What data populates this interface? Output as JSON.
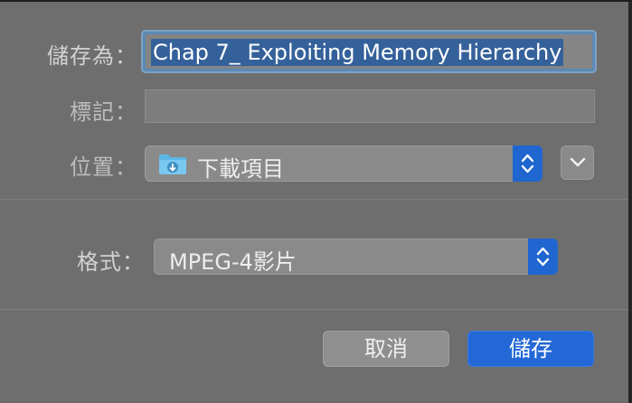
{
  "save_dialog": {
    "save_as_label": "儲存為：",
    "filename": "Chap 7_ Exploiting Memory Hierarchy",
    "tags_label": "標記：",
    "tags_value": "",
    "where_label": "位置：",
    "where_value": "下載項目",
    "format_label": "格式：",
    "format_value": "MPEG-4影片",
    "cancel_label": "取消",
    "save_label": "儲存"
  },
  "colors": {
    "accent": "#2368d6",
    "selection": "#35619a",
    "background": "#6e6e6e"
  },
  "icons": {
    "where": "downloads-folder-icon",
    "stepper": "up-down-chevron-icon",
    "expand": "chevron-down-icon"
  }
}
